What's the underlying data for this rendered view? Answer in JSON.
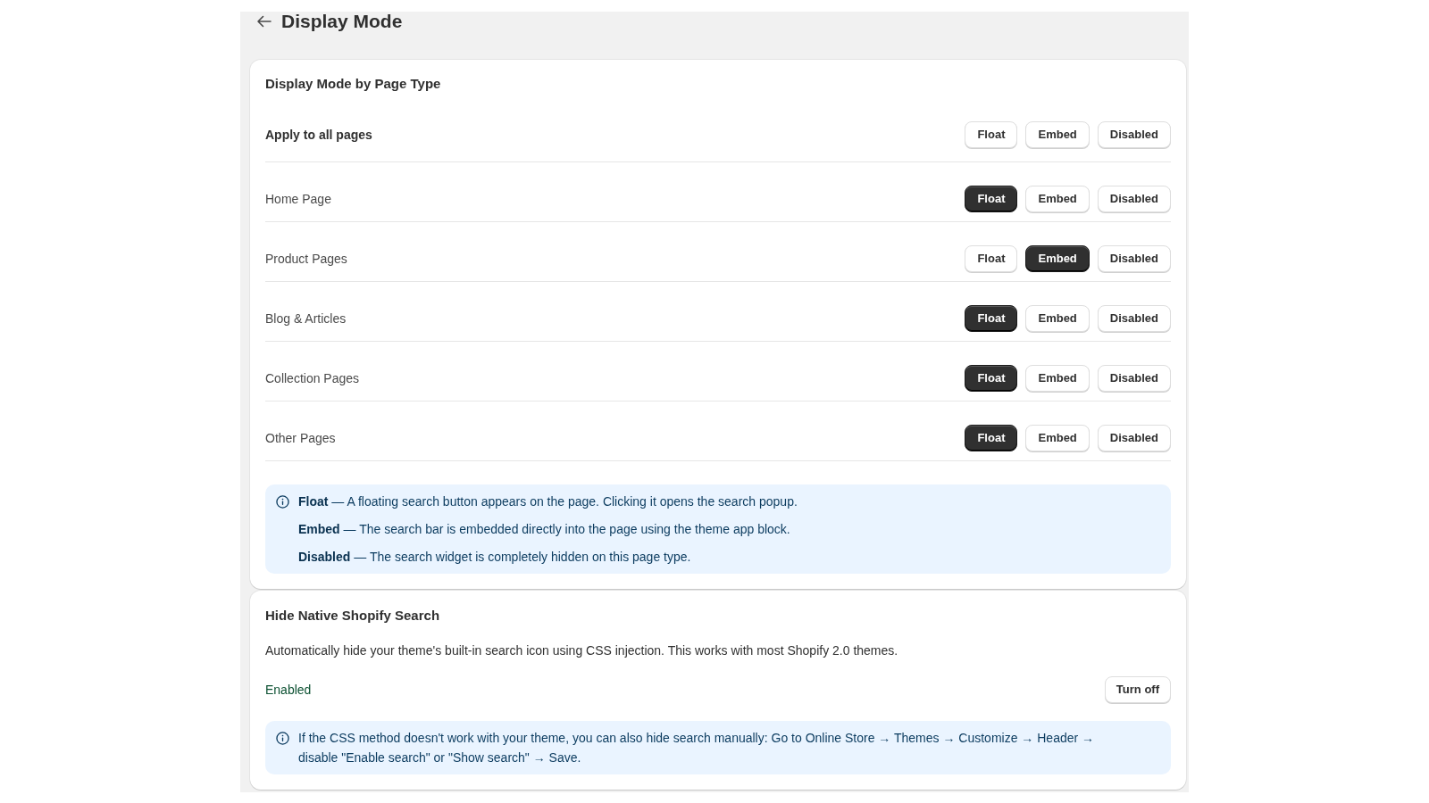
{
  "header": {
    "title": "Display Mode"
  },
  "page_type_card": {
    "title": "Display Mode by Page Type",
    "rows": [
      {
        "label": "Apply to all pages",
        "kind": "all",
        "buttons": [
          {
            "label": "Float",
            "selected": false
          },
          {
            "label": "Embed",
            "selected": false
          },
          {
            "label": "Disabled",
            "selected": false
          }
        ]
      },
      {
        "label": "Home Page",
        "kind": "page",
        "buttons": [
          {
            "label": "Float",
            "selected": true
          },
          {
            "label": "Embed",
            "selected": false
          },
          {
            "label": "Disabled",
            "selected": false
          }
        ]
      },
      {
        "label": "Product Pages",
        "kind": "page",
        "buttons": [
          {
            "label": "Float",
            "selected": false
          },
          {
            "label": "Embed",
            "selected": true
          },
          {
            "label": "Disabled",
            "selected": false
          }
        ]
      },
      {
        "label": "Blog & Articles",
        "kind": "page",
        "buttons": [
          {
            "label": "Float",
            "selected": true
          },
          {
            "label": "Embed",
            "selected": false
          },
          {
            "label": "Disabled",
            "selected": false
          }
        ]
      },
      {
        "label": "Collection Pages",
        "kind": "page",
        "buttons": [
          {
            "label": "Float",
            "selected": true
          },
          {
            "label": "Embed",
            "selected": false
          },
          {
            "label": "Disabled",
            "selected": false
          }
        ]
      },
      {
        "label": "Other Pages",
        "kind": "page",
        "buttons": [
          {
            "label": "Float",
            "selected": true
          },
          {
            "label": "Embed",
            "selected": false
          },
          {
            "label": "Disabled",
            "selected": false
          }
        ]
      }
    ],
    "info": [
      "**Float** — A floating search button appears on the page. Clicking it opens the search popup.",
      "**Embed** — The search bar is embedded directly into the page using the theme app block.",
      "**Disabled** — The search widget is completely hidden on this page type."
    ]
  },
  "hide_search_card": {
    "title": "Hide Native Shopify Search",
    "description": "Automatically hide your theme's built-in search icon using CSS injection. This works with most Shopify 2.0 themes.",
    "status": "Enabled",
    "button": "Turn off",
    "note": "If the CSS method doesn't work with your theme, you can also hide search manually: Go to Online Store → Themes → Customize → Header → disable \"Enable search\" or \"Show search\" → Save."
  }
}
